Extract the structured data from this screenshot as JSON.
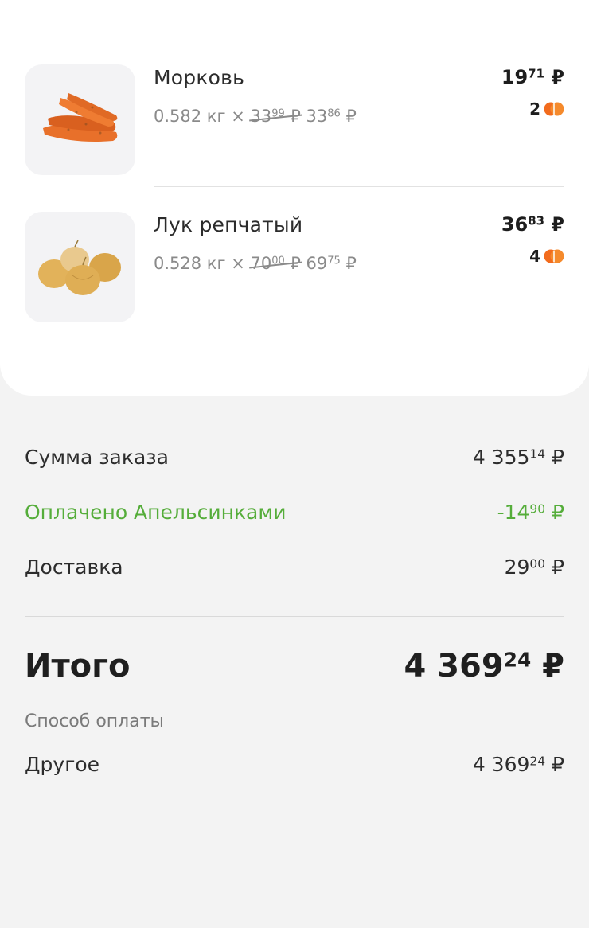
{
  "items": [
    {
      "name": "Морковь",
      "qty": "0.582 кг",
      "times": "×",
      "old_int": "33",
      "old_frac": "99",
      "new_int": "33",
      "new_frac": "86",
      "price_int": "19",
      "price_frac": "71",
      "bonus": "2",
      "image_icon": "carrot-icon"
    },
    {
      "name": "Лук репчатый",
      "qty": "0.528 кг",
      "times": "×",
      "old_int": "70",
      "old_frac": "00",
      "new_int": "69",
      "new_frac": "75",
      "price_int": "36",
      "price_frac": "83",
      "bonus": "4",
      "image_icon": "onion-icon"
    }
  ],
  "currency": "₽",
  "summary": {
    "order_sum_label": "Сумма заказа",
    "order_sum_int": "4 355",
    "order_sum_frac": "14",
    "paid_label": "Оплачено Апельсинками",
    "paid_int": "-14",
    "paid_frac": "90",
    "delivery_label": "Доставка",
    "delivery_int": "29",
    "delivery_frac": "00"
  },
  "total": {
    "label": "Итого",
    "int": "4 369",
    "frac": "24"
  },
  "payment": {
    "section_label": "Способ оплаты",
    "method": "Другое",
    "int": "4 369",
    "frac": "24"
  },
  "colors": {
    "accent_green": "#55ad3a",
    "bonus_orange": "#f26b1d"
  }
}
